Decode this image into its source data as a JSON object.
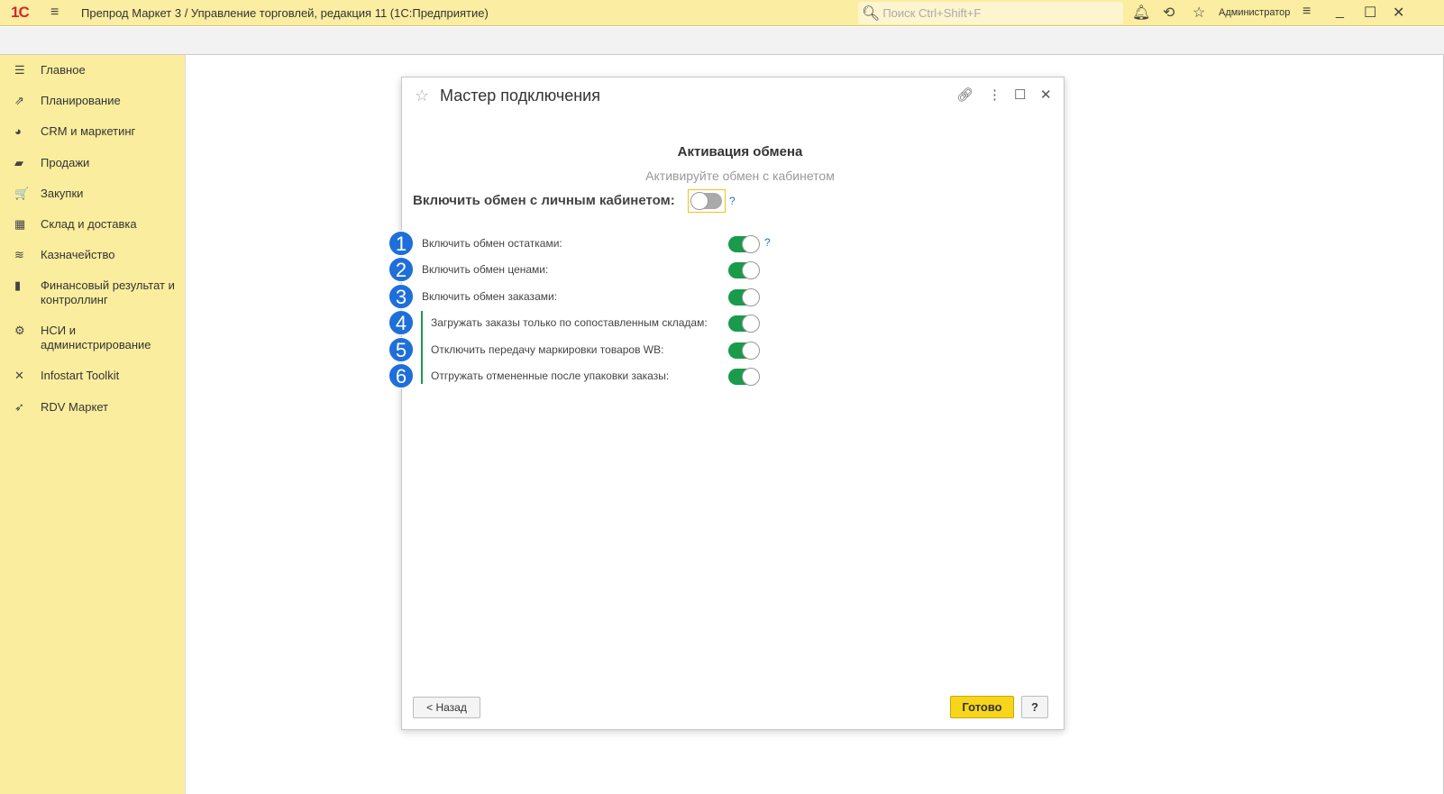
{
  "app": {
    "logo": "1С",
    "title": "Препрод Маркет 3 / Управление торговлей, редакция 11  (1С:Предприятие)",
    "search_placeholder": "Поиск Ctrl+Shift+F",
    "user": "Администратор"
  },
  "sidebar": {
    "items": [
      {
        "label": "Главное",
        "icon": "☰"
      },
      {
        "label": "Планирование",
        "icon": "⇗"
      },
      {
        "label": "CRM и маркетинг",
        "icon": "◕"
      },
      {
        "label": "Продажи",
        "icon": "▰"
      },
      {
        "label": "Закупки",
        "icon": "🛒"
      },
      {
        "label": "Склад и доставка",
        "icon": "▦"
      },
      {
        "label": "Казначейство",
        "icon": "≋"
      },
      {
        "label": "Финансовый результат и контроллинг",
        "icon": "▮"
      },
      {
        "label": "НСИ и администрирование",
        "icon": "⚙"
      },
      {
        "label": "Infostart Toolkit",
        "icon": "✕"
      },
      {
        "label": "RDV Маркет",
        "icon": "➶"
      }
    ]
  },
  "dialog": {
    "title": "Мастер подключения",
    "heading": "Активация обмена",
    "subheading": "Активируйте обмен с кабинетом",
    "main_label": "Включить обмен с личным кабинетом:",
    "main_enabled": false,
    "help": "?",
    "rows": [
      {
        "num": "1",
        "label": "Включить обмен остатками:",
        "enabled": true
      },
      {
        "num": "2",
        "label": "Включить обмен ценами:",
        "enabled": true
      },
      {
        "num": "3",
        "label": "Включить обмен заказами:",
        "enabled": true
      },
      {
        "num": "4",
        "label": "Загружать заказы только по сопоставленным складам:",
        "enabled": true
      },
      {
        "num": "5",
        "label": "Отключить передачу маркировки товаров WB:",
        "enabled": true
      },
      {
        "num": "6",
        "label": "Отгружать отмененные после упаковки заказы:",
        "enabled": true
      }
    ],
    "back": "< Назад",
    "done": "Готово",
    "help_button": "?"
  }
}
